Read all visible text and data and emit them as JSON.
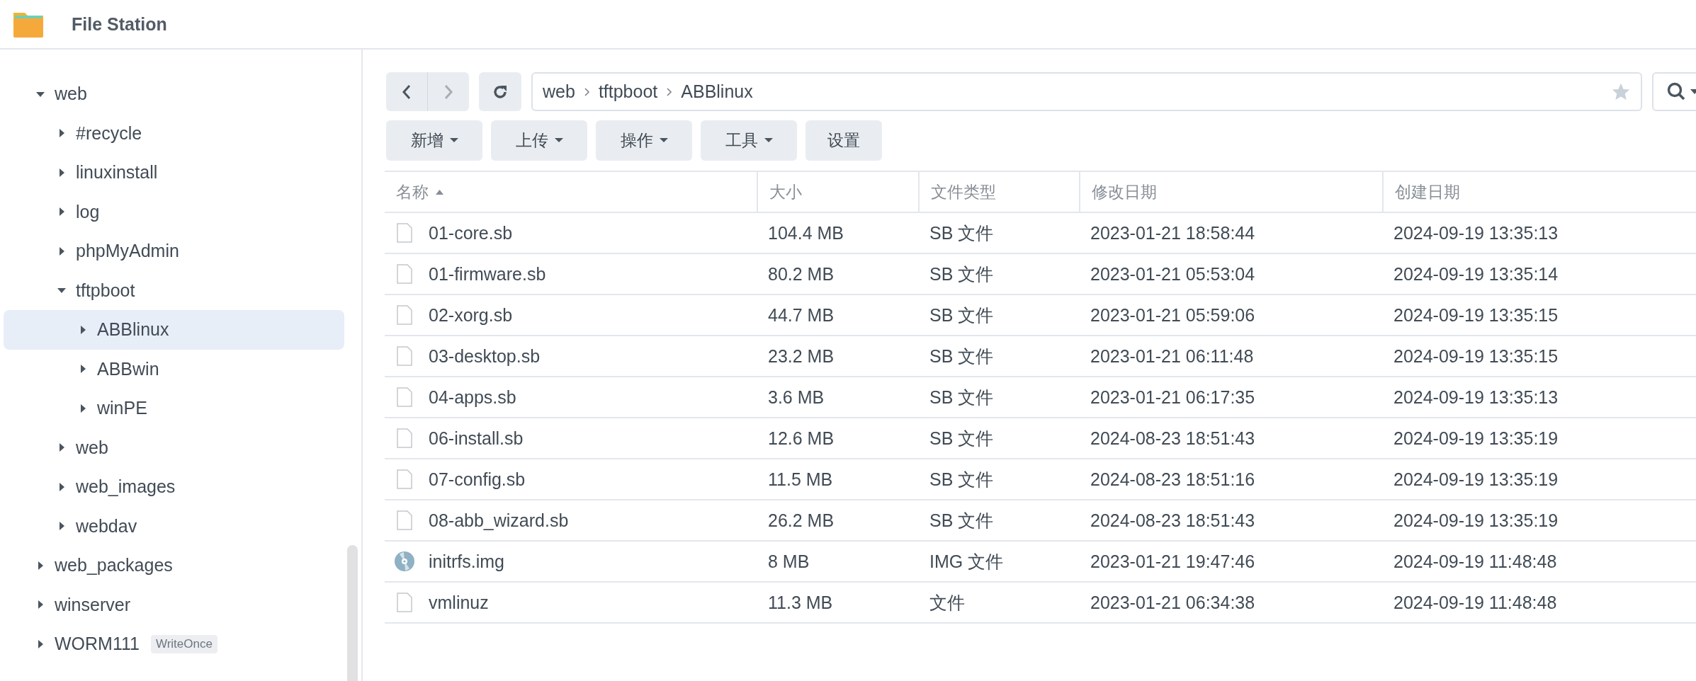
{
  "window": {
    "title": "File Station"
  },
  "sidebar": {
    "tree": [
      {
        "label": "web",
        "expanded": true,
        "selected": false,
        "children": [
          {
            "label": "#recycle",
            "expanded": false,
            "selected": false
          },
          {
            "label": "linuxinstall",
            "expanded": false,
            "selected": false
          },
          {
            "label": "log",
            "expanded": false,
            "selected": false
          },
          {
            "label": "phpMyAdmin",
            "expanded": false,
            "selected": false
          },
          {
            "label": "tftpboot",
            "expanded": true,
            "selected": false,
            "children": [
              {
                "label": "ABBlinux",
                "expanded": false,
                "selected": true
              },
              {
                "label": "ABBwin",
                "expanded": false,
                "selected": false
              },
              {
                "label": "winPE",
                "expanded": false,
                "selected": false
              }
            ]
          },
          {
            "label": "web",
            "expanded": false,
            "selected": false
          },
          {
            "label": "web_images",
            "expanded": false,
            "selected": false
          },
          {
            "label": "webdav",
            "expanded": false,
            "selected": false
          }
        ]
      },
      {
        "label": "web_packages",
        "expanded": false,
        "selected": false
      },
      {
        "label": "winserver",
        "expanded": false,
        "selected": false
      },
      {
        "label": "WORM111",
        "expanded": false,
        "selected": false,
        "badge": "WriteOnce"
      }
    ]
  },
  "path": [
    "web",
    "tftpboot",
    "ABBlinux"
  ],
  "toolbar": [
    {
      "label": "新增",
      "dropdown": true
    },
    {
      "label": "上传",
      "dropdown": true
    },
    {
      "label": "操作",
      "dropdown": true
    },
    {
      "label": "工具",
      "dropdown": true
    },
    {
      "label": "设置",
      "dropdown": false
    }
  ],
  "table": {
    "columns": [
      {
        "label": "名称",
        "sorted": true
      },
      {
        "label": "大小",
        "sorted": false
      },
      {
        "label": "文件类型",
        "sorted": false
      },
      {
        "label": "修改日期",
        "sorted": false
      },
      {
        "label": "创建日期",
        "sorted": false
      }
    ],
    "rows": [
      {
        "kind": "document",
        "cells": [
          "01-core.sb",
          "104.4 MB",
          "SB 文件",
          "2023-01-21 18:58:44",
          "2024-09-19 13:35:13"
        ]
      },
      {
        "kind": "document",
        "cells": [
          "01-firmware.sb",
          "80.2 MB",
          "SB 文件",
          "2023-01-21 05:53:04",
          "2024-09-19 13:35:14"
        ]
      },
      {
        "kind": "document",
        "cells": [
          "02-xorg.sb",
          "44.7 MB",
          "SB 文件",
          "2023-01-21 05:59:06",
          "2024-09-19 13:35:15"
        ]
      },
      {
        "kind": "document",
        "cells": [
          "03-desktop.sb",
          "23.2 MB",
          "SB 文件",
          "2023-01-21 06:11:48",
          "2024-09-19 13:35:15"
        ]
      },
      {
        "kind": "document",
        "cells": [
          "04-apps.sb",
          "3.6 MB",
          "SB 文件",
          "2023-01-21 06:17:35",
          "2024-09-19 13:35:13"
        ]
      },
      {
        "kind": "document",
        "cells": [
          "06-install.sb",
          "12.6 MB",
          "SB 文件",
          "2024-08-23 18:51:43",
          "2024-09-19 13:35:19"
        ]
      },
      {
        "kind": "document",
        "cells": [
          "07-config.sb",
          "11.5 MB",
          "SB 文件",
          "2024-08-23 18:51:16",
          "2024-09-19 13:35:19"
        ]
      },
      {
        "kind": "document",
        "cells": [
          "08-abb_wizard.sb",
          "26.2 MB",
          "SB 文件",
          "2024-08-23 18:51:43",
          "2024-09-19 13:35:19"
        ]
      },
      {
        "kind": "disc",
        "cells": [
          "initrfs.img",
          "8 MB",
          "IMG 文件",
          "2023-01-21 19:47:46",
          "2024-09-19 11:48:48"
        ]
      },
      {
        "kind": "document",
        "cells": [
          "vmlinuz",
          "11.3 MB",
          "文件",
          "2023-01-21 06:34:38",
          "2024-09-19 11:48:48"
        ]
      }
    ]
  }
}
